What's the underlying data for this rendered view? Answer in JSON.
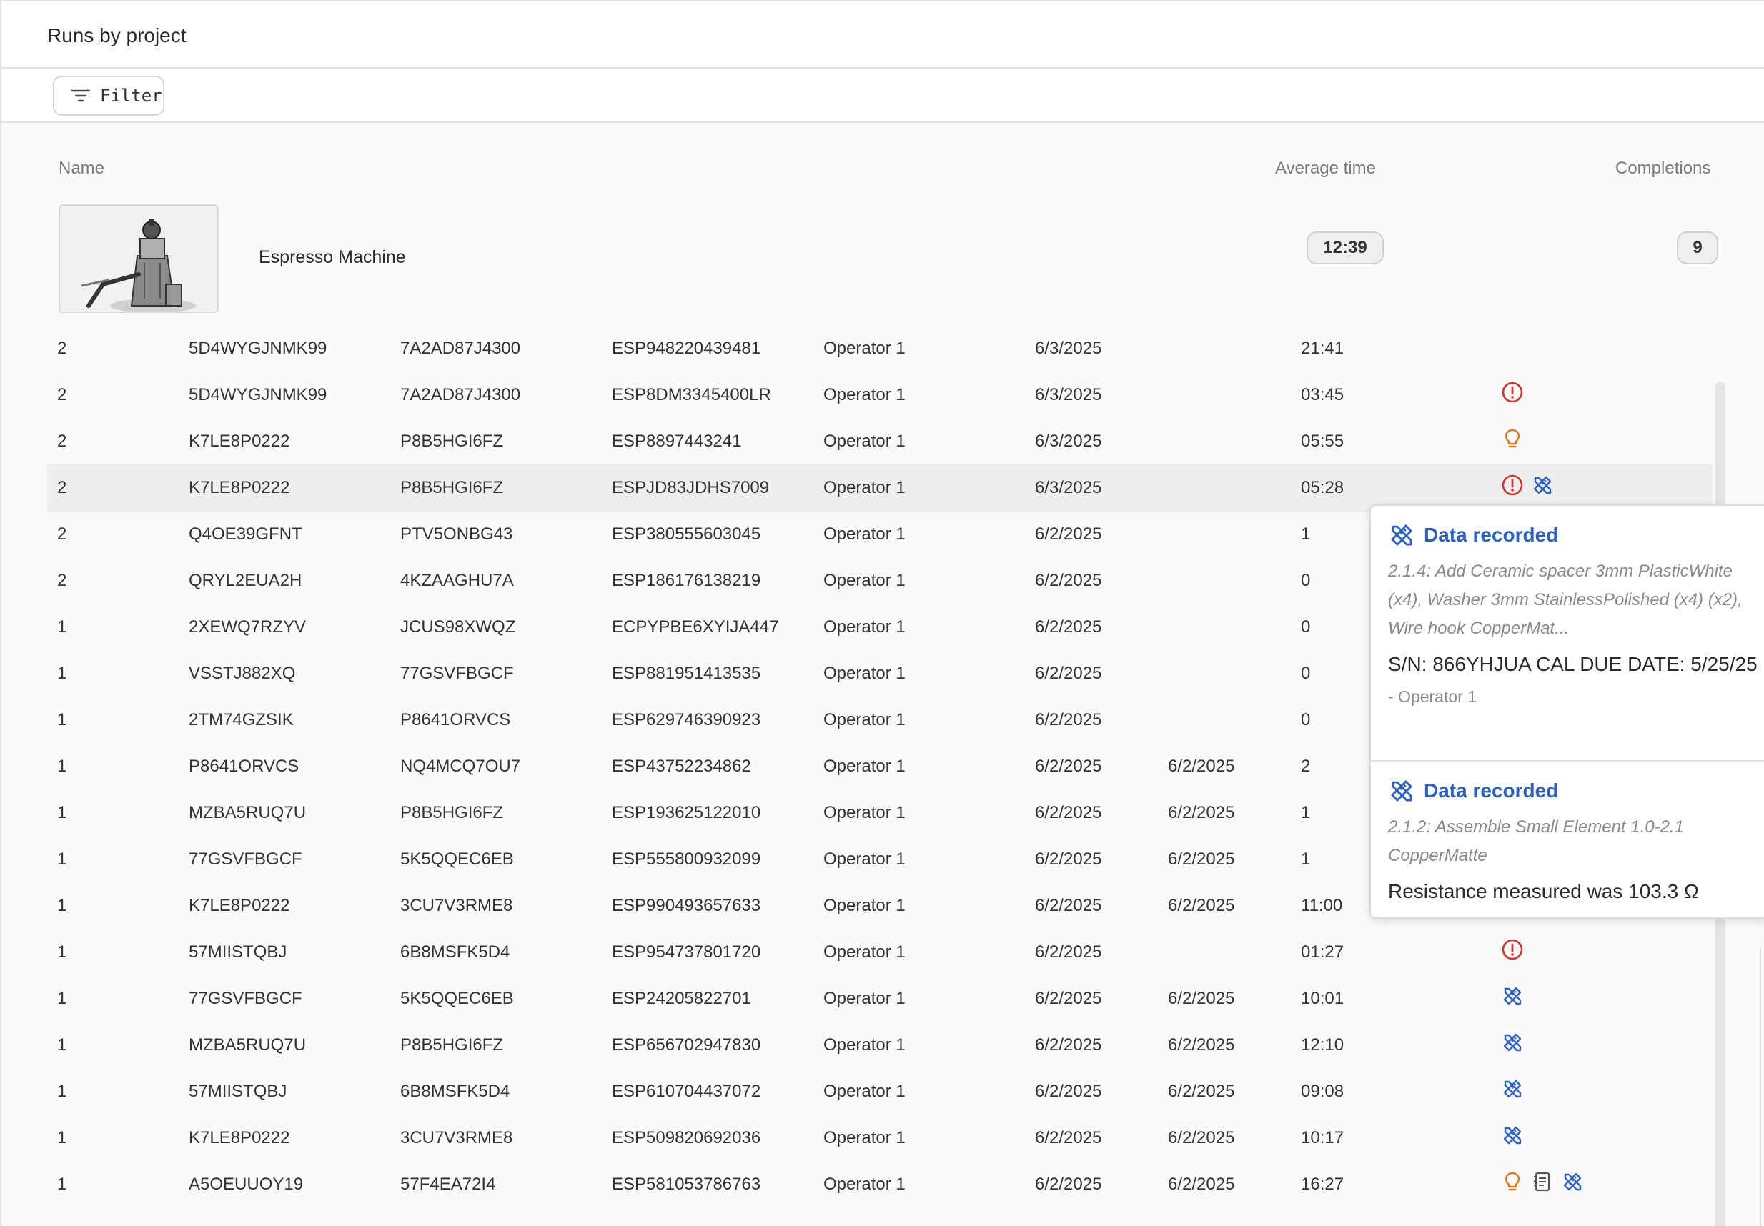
{
  "header": {
    "title": "Runs by project"
  },
  "toolbar": {
    "filter_label": "Filter",
    "filter_icon": "filter-lines-icon"
  },
  "table": {
    "col_name": "Name",
    "col_avg_time": "Average time",
    "col_completions": "Completions"
  },
  "project": {
    "name": "Espresso Machine",
    "avg_time": "12:39",
    "completions": "9",
    "thumbnail_icon": "espresso-machine-image"
  },
  "colors": {
    "error": "#d7322b",
    "idea": "#e07a1f",
    "data": "#2c61c4"
  },
  "rows": [
    {
      "qty": "2",
      "a": "5D4WYGJNMK99",
      "b": "7A2AD87J4300",
      "serial": "ESP948220439481",
      "op": "Operator 1",
      "d1": "6/3/2025",
      "d2": "",
      "time": "21:41",
      "icons": []
    },
    {
      "qty": "2",
      "a": "5D4WYGJNMK99",
      "b": "7A2AD87J4300",
      "serial": "ESP8DM3345400LR",
      "op": "Operator 1",
      "d1": "6/3/2025",
      "d2": "",
      "time": "03:45",
      "icons": [
        "error"
      ]
    },
    {
      "qty": "2",
      "a": "K7LE8P0222",
      "b": "P8B5HGI6FZ",
      "serial": "ESP8897443241",
      "op": "Operator 1",
      "d1": "6/3/2025",
      "d2": "",
      "time": "05:55",
      "icons": [
        "idea"
      ]
    },
    {
      "qty": "2",
      "a": "K7LE8P0222",
      "b": "P8B5HGI6FZ",
      "serial": "ESPJD83JDHS7009",
      "op": "Operator 1",
      "d1": "6/3/2025",
      "d2": "",
      "time": "05:28",
      "icons": [
        "error",
        "data"
      ],
      "highlight": true
    },
    {
      "qty": "2",
      "a": "Q4OE39GFNT",
      "b": "PTV5ONBG43",
      "serial": "ESP380555603045",
      "op": "Operator 1",
      "d1": "6/2/2025",
      "d2": "",
      "time": "1",
      "icons": []
    },
    {
      "qty": "2",
      "a": "QRYL2EUA2H",
      "b": "4KZAAGHU7A",
      "serial": "ESP186176138219",
      "op": "Operator 1",
      "d1": "6/2/2025",
      "d2": "",
      "time": "0",
      "icons": []
    },
    {
      "qty": "1",
      "a": "2XEWQ7RZYV",
      "b": "JCUS98XWQZ",
      "serial": "ECPYPBE6XYIJA447",
      "op": "Operator 1",
      "d1": "6/2/2025",
      "d2": "",
      "time": "0",
      "icons": []
    },
    {
      "qty": "1",
      "a": "VSSTJ882XQ",
      "b": "77GSVFBGCF",
      "serial": "ESP881951413535",
      "op": "Operator 1",
      "d1": "6/2/2025",
      "d2": "",
      "time": "0",
      "icons": []
    },
    {
      "qty": "1",
      "a": "2TM74GZSIK",
      "b": "P8641ORVCS",
      "serial": "ESP629746390923",
      "op": "Operator 1",
      "d1": "6/2/2025",
      "d2": "",
      "time": "0",
      "icons": []
    },
    {
      "qty": "1",
      "a": "P8641ORVCS",
      "b": "NQ4MCQ7OU7",
      "serial": "ESP43752234862",
      "op": "Operator 1",
      "d1": "6/2/2025",
      "d2": "6/2/2025",
      "time": "2",
      "icons": []
    },
    {
      "qty": "1",
      "a": "MZBA5RUQ7U",
      "b": "P8B5HGI6FZ",
      "serial": "ESP193625122010",
      "op": "Operator 1",
      "d1": "6/2/2025",
      "d2": "6/2/2025",
      "time": "1",
      "icons": []
    },
    {
      "qty": "1",
      "a": "77GSVFBGCF",
      "b": "5K5QQEC6EB",
      "serial": "ESP555800932099",
      "op": "Operator 1",
      "d1": "6/2/2025",
      "d2": "6/2/2025",
      "time": "1",
      "icons": []
    },
    {
      "qty": "1",
      "a": "K7LE8P0222",
      "b": "3CU7V3RME8",
      "serial": "ESP990493657633",
      "op": "Operator 1",
      "d1": "6/2/2025",
      "d2": "6/2/2025",
      "time": "11:00",
      "icons": [
        "idea",
        "data"
      ]
    },
    {
      "qty": "1",
      "a": "57MIISTQBJ",
      "b": "6B8MSFK5D4",
      "serial": "ESP954737801720",
      "op": "Operator 1",
      "d1": "6/2/2025",
      "d2": "",
      "time": "01:27",
      "icons": [
        "error"
      ]
    },
    {
      "qty": "1",
      "a": "77GSVFBGCF",
      "b": "5K5QQEC6EB",
      "serial": "ESP24205822701",
      "op": "Operator 1",
      "d1": "6/2/2025",
      "d2": "6/2/2025",
      "time": "10:01",
      "icons": [
        "data"
      ]
    },
    {
      "qty": "1",
      "a": "MZBA5RUQ7U",
      "b": "P8B5HGI6FZ",
      "serial": "ESP656702947830",
      "op": "Operator 1",
      "d1": "6/2/2025",
      "d2": "6/2/2025",
      "time": "12:10",
      "icons": [
        "data"
      ]
    },
    {
      "qty": "1",
      "a": "57MIISTQBJ",
      "b": "6B8MSFK5D4",
      "serial": "ESP610704437072",
      "op": "Operator 1",
      "d1": "6/2/2025",
      "d2": "6/2/2025",
      "time": "09:08",
      "icons": [
        "data"
      ]
    },
    {
      "qty": "1",
      "a": "K7LE8P0222",
      "b": "3CU7V3RME8",
      "serial": "ESP509820692036",
      "op": "Operator 1",
      "d1": "6/2/2025",
      "d2": "6/2/2025",
      "time": "10:17",
      "icons": [
        "data"
      ]
    },
    {
      "qty": "1",
      "a": "A5OEUUOY19",
      "b": "57F4EA72I4",
      "serial": "ESP581053786763",
      "op": "Operator 1",
      "d1": "6/2/2025",
      "d2": "6/2/2025",
      "time": "16:27",
      "icons": [
        "idea",
        "note",
        "data"
      ]
    }
  ],
  "popover": {
    "entries": [
      {
        "title": "Data recorded",
        "icon": "data-recorded-icon",
        "step": "2.1.4: Add Ceramic spacer 3mm PlasticWhite (x4), Washer 3mm StainlessPolished (x4) (x2), Wire hook CopperMat...",
        "value": "S/N: 866YHJUA CAL DUE DATE: 5/25/25",
        "author": "- Operator 1"
      },
      {
        "title": "Data recorded",
        "icon": "data-recorded-icon",
        "step": "2.1.2: Assemble Small Element 1.0-2.1 CopperMatte",
        "value": "Resistance measured was 103.3 Ω",
        "author": ""
      }
    ]
  }
}
